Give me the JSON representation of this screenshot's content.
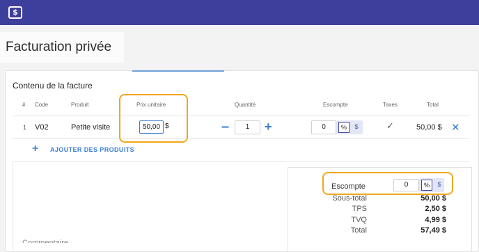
{
  "app": {
    "logo_icon": "dollar-box-icon",
    "logo_glyph": "$",
    "header_color": "#3e3e9c"
  },
  "page": {
    "title": "Facturation privée"
  },
  "invoice": {
    "section_title": "Contenu de la facture",
    "columns": {
      "num": "#",
      "code": "Code",
      "product": "Produit",
      "unit_price": "Prix unitaire",
      "quantity": "Quantité",
      "discount": "Escompte",
      "taxes": "Taxes",
      "total": "Total"
    },
    "rows": [
      {
        "num": "1",
        "code": "V02",
        "product": "Petite visite",
        "unit_price": "50,00",
        "currency": "$",
        "quantity": "1",
        "discount": "0",
        "discount_percent": "%",
        "discount_dollar": "$",
        "total": "50,00 $"
      }
    ],
    "add_products_label": "AJOUTER DES PRODUITS",
    "cutoff_text": "Commentaire"
  },
  "summary": {
    "discount_label": "Escompte",
    "discount_value": "0",
    "discount_percent": "%",
    "discount_dollar": "$",
    "subtotal_label": "Sous-total",
    "subtotal_value": "50,00 $",
    "tps_label": "TPS",
    "tps_value": "2,50 $",
    "tvq_label": "TVQ",
    "tvq_value": "4,99 $",
    "total_label": "Total",
    "total_value": "57,49 $"
  },
  "colors": {
    "accent": "#3b7fd4",
    "highlight": "#f0a81c",
    "toggle_bg": "#e3e6f4"
  }
}
